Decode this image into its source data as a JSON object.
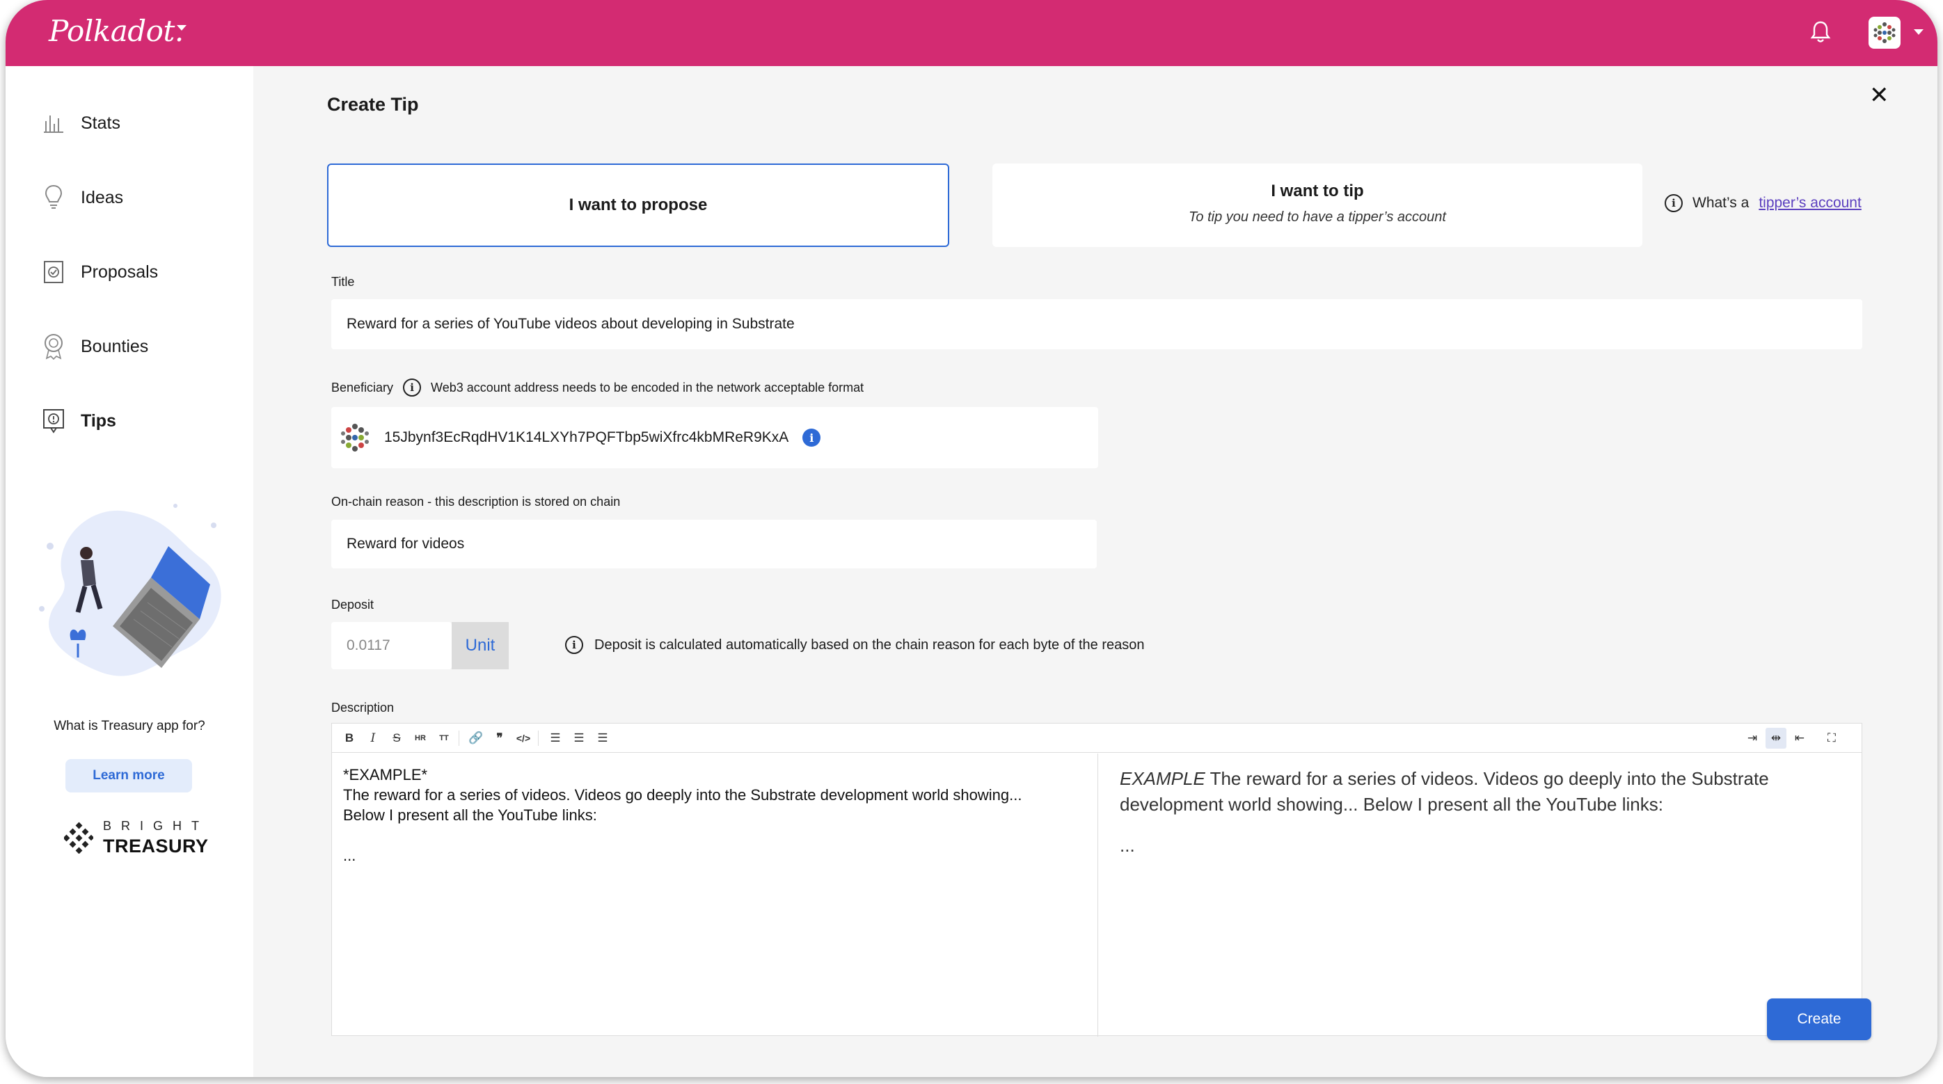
{
  "app": {
    "logo_text": "Polkadot."
  },
  "colors": {
    "brand": "#d32b72",
    "accent": "#2e6ad6",
    "link": "#5b3fbf"
  },
  "sidebar": {
    "items": [
      {
        "label": "Stats",
        "icon": "stats-icon"
      },
      {
        "label": "Ideas",
        "icon": "lightbulb-icon"
      },
      {
        "label": "Proposals",
        "icon": "proposal-icon"
      },
      {
        "label": "Bounties",
        "icon": "bounty-badge-icon"
      },
      {
        "label": "Tips",
        "icon": "tips-icon",
        "active": true
      }
    ],
    "question": "What is Treasury app for?",
    "learn_more": "Learn more",
    "brand_top": "BRIGHT",
    "brand_bottom": "TREASURY"
  },
  "main": {
    "title": "Create Tip",
    "option_propose": "I want to propose",
    "option_tip_title": "I want to tip",
    "option_tip_sub": "To tip you need to have a tipper’s account",
    "info_prefix": "What’s a",
    "info_link": "tipper’s account",
    "title_label": "Title",
    "title_value": "Reward for a series of YouTube videos about developing in Substrate",
    "beneficiary_label": "Beneficiary",
    "beneficiary_hint": "Web3 account address needs to be encoded in the network acceptable format",
    "beneficiary_address": "15Jbynf3EcRqdHV1K14LXYh7PQFTbp5wiXfrc4kbMReR9KxA",
    "reason_label": "On-chain reason - this description is stored on chain",
    "reason_value": "Reward for videos",
    "deposit_label": "Deposit",
    "deposit_value": "0.0117",
    "deposit_unit": "Unit",
    "deposit_hint": "Deposit is calculated automatically based on the chain reason for each byte of the reason",
    "description_label": "Description",
    "editor": {
      "source_line1": "*EXAMPLE*",
      "source_line2": "The reward for a series of videos. Videos go deeply into the Substrate development world showing...",
      "source_line3": "Below I present all the YouTube links:",
      "source_line4": "...",
      "preview_em": "EXAMPLE",
      "preview_text": " The reward for a series of videos. Videos go deeply into the Substrate development world showing... Below I present all the YouTube links:",
      "preview_ellipsis": "..."
    },
    "create_button": "Create"
  }
}
